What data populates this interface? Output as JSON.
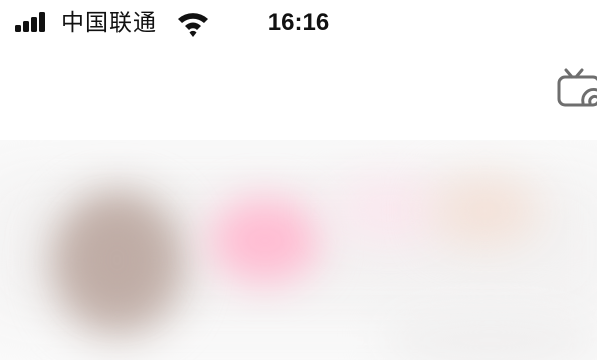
{
  "status_bar": {
    "carrier": "中国联通",
    "time": "16:16",
    "signal_icon": "cellular-signal-icon",
    "wifi_icon": "wifi-icon"
  },
  "nav_bar": {
    "tv_icon": "tv-icon"
  },
  "content": {
    "state": "blurred-loading",
    "colors": {
      "avatar": "#c4b2ab",
      "pink": "#ffbcd2",
      "peach": "#f3e1d8",
      "background": "#fafafa"
    }
  }
}
